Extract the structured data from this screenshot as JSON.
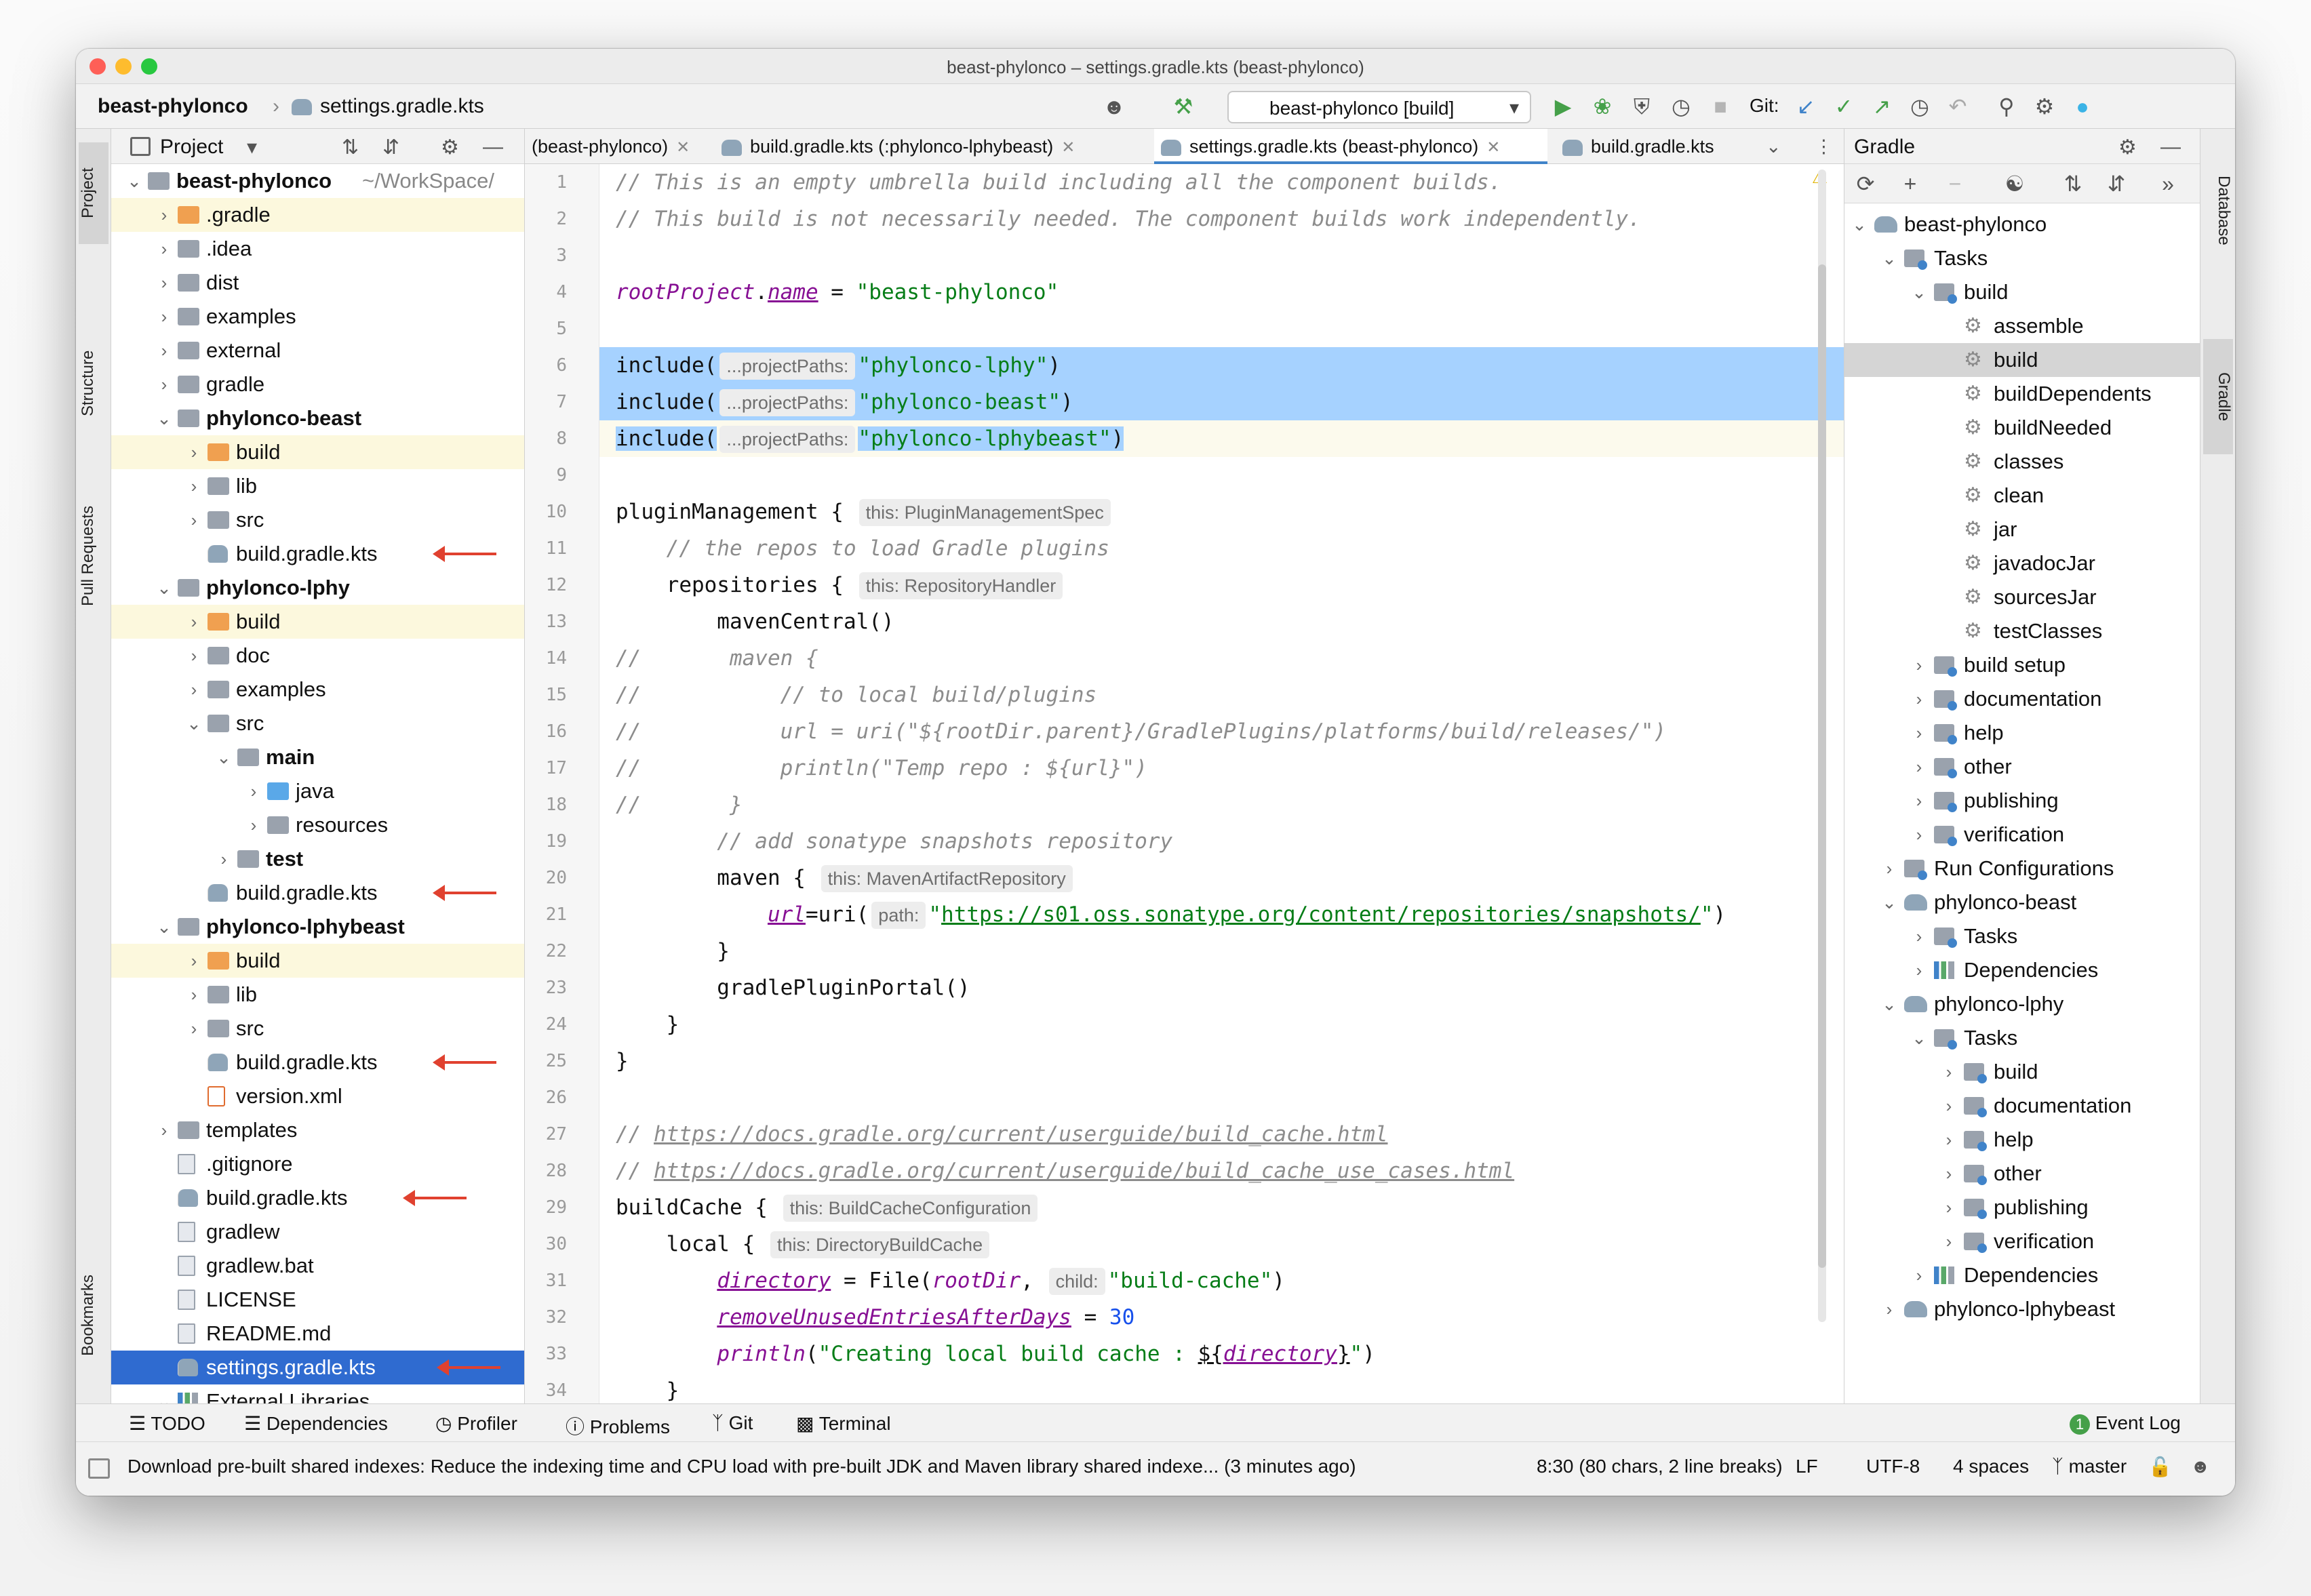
{
  "window": {
    "title": "beast-phylonco – settings.gradle.kts (beast-phylonco)",
    "traffic_colors": [
      "#fe5f57",
      "#febc2e",
      "#28c840"
    ]
  },
  "navbar": {
    "project": "beast-phylonco",
    "file": "settings.gradle.kts",
    "run_config": "beast-phylonco [build]",
    "git_label": "Git:"
  },
  "left_stripe": [
    "Project",
    "Structure",
    "Pull Requests",
    "Bookmarks"
  ],
  "right_stripe": [
    "Database",
    "Gradle"
  ],
  "project_panel": {
    "title": "Project",
    "root_label": "beast-phylonco",
    "root_path": "~/WorkSpace/",
    "items": [
      {
        "label": ".gradle",
        "depth": 1,
        "icon": "orange",
        "chev": "›",
        "hl": true
      },
      {
        "label": ".idea",
        "depth": 1,
        "icon": "grey",
        "chev": "›"
      },
      {
        "label": "dist",
        "depth": 1,
        "icon": "grey",
        "chev": "›"
      },
      {
        "label": "examples",
        "depth": 1,
        "icon": "grey",
        "chev": "›"
      },
      {
        "label": "external",
        "depth": 1,
        "icon": "grey",
        "chev": "›"
      },
      {
        "label": "gradle",
        "depth": 1,
        "icon": "grey",
        "chev": "›"
      },
      {
        "label": "phylonco-beast",
        "depth": 1,
        "icon": "grey",
        "chev": "⌄",
        "bold": true
      },
      {
        "label": "build",
        "depth": 2,
        "icon": "orange",
        "chev": "›",
        "hl": true
      },
      {
        "label": "lib",
        "depth": 2,
        "icon": "grey",
        "chev": "›"
      },
      {
        "label": "src",
        "depth": 2,
        "icon": "grey",
        "chev": "›"
      },
      {
        "label": "build.gradle.kts",
        "depth": 2,
        "icon": "gradle",
        "arrow": true
      },
      {
        "label": "phylonco-lphy",
        "depth": 1,
        "icon": "grey",
        "chev": "⌄",
        "bold": true
      },
      {
        "label": "build",
        "depth": 2,
        "icon": "orange",
        "chev": "›",
        "hl": true
      },
      {
        "label": "doc",
        "depth": 2,
        "icon": "grey",
        "chev": "›"
      },
      {
        "label": "examples",
        "depth": 2,
        "icon": "grey",
        "chev": "›"
      },
      {
        "label": "src",
        "depth": 2,
        "icon": "grey",
        "chev": "⌄"
      },
      {
        "label": "main",
        "depth": 3,
        "icon": "grey",
        "chev": "⌄",
        "bold": true
      },
      {
        "label": "java",
        "depth": 4,
        "icon": "blue",
        "chev": "›"
      },
      {
        "label": "resources",
        "depth": 4,
        "icon": "grey",
        "chev": "›"
      },
      {
        "label": "test",
        "depth": 3,
        "icon": "grey",
        "chev": "›",
        "bold": true
      },
      {
        "label": "build.gradle.kts",
        "depth": 2,
        "icon": "gradle",
        "arrow": true
      },
      {
        "label": "phylonco-lphybeast",
        "depth": 1,
        "icon": "grey",
        "chev": "⌄",
        "bold": true
      },
      {
        "label": "build",
        "depth": 2,
        "icon": "orange",
        "chev": "›",
        "hl": true
      },
      {
        "label": "lib",
        "depth": 2,
        "icon": "grey",
        "chev": "›"
      },
      {
        "label": "src",
        "depth": 2,
        "icon": "grey",
        "chev": "›"
      },
      {
        "label": "build.gradle.kts",
        "depth": 2,
        "icon": "gradle",
        "arrow": true
      },
      {
        "label": "version.xml",
        "depth": 2,
        "icon": "xml"
      },
      {
        "label": "templates",
        "depth": 1,
        "icon": "grey",
        "chev": "›"
      },
      {
        "label": ".gitignore",
        "depth": 1,
        "icon": "file"
      },
      {
        "label": "build.gradle.kts",
        "depth": 1,
        "icon": "gradle",
        "arrow": true
      },
      {
        "label": "gradlew",
        "depth": 1,
        "icon": "file"
      },
      {
        "label": "gradlew.bat",
        "depth": 1,
        "icon": "file"
      },
      {
        "label": "LICENSE",
        "depth": 1,
        "icon": "file"
      },
      {
        "label": "README.md",
        "depth": 1,
        "icon": "file"
      },
      {
        "label": "settings.gradle.kts",
        "depth": 1,
        "icon": "gradle",
        "arrow": true,
        "sel": true
      },
      {
        "label": "External Libraries",
        "depth": 1,
        "icon": "deps",
        "chev": "⌄"
      }
    ]
  },
  "editor": {
    "tabs": [
      {
        "label": "(beast-phylonco)",
        "active": false
      },
      {
        "label": "build.gradle.kts (:phylonco-lphybeast)",
        "active": false
      },
      {
        "label": "settings.gradle.kts (beast-phylonco)",
        "active": true
      },
      {
        "label": "build.gradle.kts",
        "active": false
      }
    ],
    "lines": [
      {
        "n": "1",
        "t": [
          [
            "cm",
            "// This is an empty umbrella build including all the component builds."
          ]
        ]
      },
      {
        "n": "2",
        "t": [
          [
            "cm",
            "// This build is not necessarily needed. The component builds work independently."
          ]
        ]
      },
      {
        "n": "3",
        "t": []
      },
      {
        "n": "4",
        "t": [
          [
            "prop",
            "rootProject"
          ],
          [
            "",
            "."
          ],
          [
            "prop und",
            "name"
          ],
          [
            "",
            " = "
          ],
          [
            "str",
            "\"beast-phylonco\""
          ]
        ]
      },
      {
        "n": "5",
        "t": []
      },
      {
        "n": "6",
        "bg": "sel",
        "t": [
          [
            "",
            "include("
          ],
          [
            "hint",
            "...projectPaths:"
          ],
          [
            "str",
            "\"phylonco-lphy\""
          ],
          [
            "",
            ")"
          ]
        ]
      },
      {
        "n": "7",
        "bg": "sel",
        "t": [
          [
            "",
            "include("
          ],
          [
            "hint",
            "...projectPaths:"
          ],
          [
            "str",
            "\"phylonco-beast\""
          ],
          [
            "",
            ")"
          ]
        ]
      },
      {
        "n": "8",
        "bg": "cursel",
        "t": [
          [
            "",
            "include("
          ],
          [
            "hint",
            "...projectPaths:"
          ],
          [
            "str",
            "\"phylonco-lphybeast\""
          ],
          [
            "",
            ")"
          ]
        ]
      },
      {
        "n": "9",
        "t": []
      },
      {
        "n": "10",
        "t": [
          [
            "",
            "pluginManagement { "
          ],
          [
            "hint",
            "this: PluginManagementSpec"
          ]
        ]
      },
      {
        "n": "11",
        "t": [
          [
            "cm",
            "    // the repos to load Gradle plugins"
          ]
        ]
      },
      {
        "n": "12",
        "t": [
          [
            "",
            "    repositories { "
          ],
          [
            "hint",
            "this: RepositoryHandler"
          ]
        ]
      },
      {
        "n": "13",
        "t": [
          [
            "",
            "        mavenCentral()"
          ]
        ]
      },
      {
        "n": "14",
        "t": [
          [
            "cm",
            "//       maven {"
          ]
        ]
      },
      {
        "n": "15",
        "t": [
          [
            "cm",
            "//           // to local build/plugins"
          ]
        ]
      },
      {
        "n": "16",
        "t": [
          [
            "cm",
            "//           url = uri(\"${rootDir.parent}/GradlePlugins/platforms/build/releases/\")"
          ]
        ]
      },
      {
        "n": "17",
        "t": [
          [
            "cm",
            "//           println(\"Temp repo : ${url}\")"
          ]
        ]
      },
      {
        "n": "18",
        "t": [
          [
            "cm",
            "//       }"
          ]
        ]
      },
      {
        "n": "19",
        "t": [
          [
            "cm",
            "        // add sonatype snapshots repository"
          ]
        ]
      },
      {
        "n": "20",
        "t": [
          [
            "",
            "        maven { "
          ],
          [
            "hint",
            "this: MavenArtifactRepository"
          ]
        ]
      },
      {
        "n": "21",
        "t": [
          [
            "",
            "            "
          ],
          [
            "prop und",
            "url"
          ],
          [
            "",
            "=uri("
          ],
          [
            "hint",
            "path:"
          ],
          [
            "str",
            "\""
          ],
          [
            "link",
            "https://s01.oss.sonatype.org/content/repositories/snapshots/"
          ],
          [
            "str",
            "\""
          ],
          [
            "",
            ")"
          ]
        ]
      },
      {
        "n": "22",
        "t": [
          [
            "",
            "        }"
          ]
        ]
      },
      {
        "n": "23",
        "t": [
          [
            "",
            "        gradlePluginPortal()"
          ]
        ]
      },
      {
        "n": "24",
        "t": [
          [
            "",
            "    }"
          ]
        ]
      },
      {
        "n": "25",
        "t": [
          [
            "",
            "}"
          ]
        ]
      },
      {
        "n": "26",
        "t": []
      },
      {
        "n": "27",
        "t": [
          [
            "cm",
            "// "
          ],
          [
            "cm-link",
            "https://docs.gradle.org/current/userguide/build_cache.html"
          ]
        ]
      },
      {
        "n": "28",
        "t": [
          [
            "cm",
            "// "
          ],
          [
            "cm-link",
            "https://docs.gradle.org/current/userguide/build_cache_use_cases.html"
          ]
        ]
      },
      {
        "n": "29",
        "t": [
          [
            "",
            "buildCache { "
          ],
          [
            "hint",
            "this: BuildCacheConfiguration"
          ]
        ]
      },
      {
        "n": "30",
        "t": [
          [
            "",
            "    local { "
          ],
          [
            "hint",
            "this: DirectoryBuildCache"
          ]
        ]
      },
      {
        "n": "31",
        "t": [
          [
            "",
            "        "
          ],
          [
            "prop und",
            "directory"
          ],
          [
            "",
            " = File("
          ],
          [
            "prop",
            "rootDir"
          ],
          [
            "",
            ", "
          ],
          [
            "hint",
            "child:"
          ],
          [
            "str",
            "\"build-cache\""
          ],
          [
            "",
            ")"
          ]
        ]
      },
      {
        "n": "32",
        "t": [
          [
            "",
            "        "
          ],
          [
            "prop und",
            "removeUnusedEntriesAfterDays"
          ],
          [
            "",
            " = "
          ],
          [
            "num",
            "30"
          ]
        ]
      },
      {
        "n": "33",
        "t": [
          [
            "",
            "        "
          ],
          [
            "prop",
            "println"
          ],
          [
            "",
            "("
          ],
          [
            "str",
            "\"Creating local build cache : "
          ],
          [
            "und",
            "${"
          ],
          [
            "prop und",
            "directory"
          ],
          [
            "und",
            "}"
          ],
          [
            "str",
            "\""
          ],
          [
            "",
            ")"
          ]
        ]
      },
      {
        "n": "34",
        "t": [
          [
            "",
            "    }"
          ]
        ]
      }
    ]
  },
  "gradle_panel": {
    "title": "Gradle",
    "items": [
      {
        "label": "beast-phylonco",
        "depth": 0,
        "icon": "elephant",
        "chev": "⌄"
      },
      {
        "label": "Tasks",
        "depth": 1,
        "icon": "gfolder",
        "chev": "⌄"
      },
      {
        "label": "build",
        "depth": 2,
        "icon": "gfolder",
        "chev": "⌄"
      },
      {
        "label": "assemble",
        "depth": 3,
        "icon": "gear"
      },
      {
        "label": "build",
        "depth": 3,
        "icon": "gear",
        "sel": true
      },
      {
        "label": "buildDependents",
        "depth": 3,
        "icon": "gear"
      },
      {
        "label": "buildNeeded",
        "depth": 3,
        "icon": "gear"
      },
      {
        "label": "classes",
        "depth": 3,
        "icon": "gear"
      },
      {
        "label": "clean",
        "depth": 3,
        "icon": "gear"
      },
      {
        "label": "jar",
        "depth": 3,
        "icon": "gear"
      },
      {
        "label": "javadocJar",
        "depth": 3,
        "icon": "gear"
      },
      {
        "label": "sourcesJar",
        "depth": 3,
        "icon": "gear"
      },
      {
        "label": "testClasses",
        "depth": 3,
        "icon": "gear"
      },
      {
        "label": "build setup",
        "depth": 2,
        "icon": "gfolder",
        "chev": "›"
      },
      {
        "label": "documentation",
        "depth": 2,
        "icon": "gfolder",
        "chev": "›"
      },
      {
        "label": "help",
        "depth": 2,
        "icon": "gfolder",
        "chev": "›"
      },
      {
        "label": "other",
        "depth": 2,
        "icon": "gfolder",
        "chev": "›"
      },
      {
        "label": "publishing",
        "depth": 2,
        "icon": "gfolder",
        "chev": "›"
      },
      {
        "label": "verification",
        "depth": 2,
        "icon": "gfolder",
        "chev": "›"
      },
      {
        "label": "Run Configurations",
        "depth": 1,
        "icon": "gfolder",
        "chev": "›"
      },
      {
        "label": "phylonco-beast",
        "depth": 1,
        "icon": "elephant",
        "chev": "⌄"
      },
      {
        "label": "Tasks",
        "depth": 2,
        "icon": "gfolder",
        "chev": "›"
      },
      {
        "label": "Dependencies",
        "depth": 2,
        "icon": "deps",
        "chev": "›"
      },
      {
        "label": "phylonco-lphy",
        "depth": 1,
        "icon": "elephant",
        "chev": "⌄"
      },
      {
        "label": "Tasks",
        "depth": 2,
        "icon": "gfolder",
        "chev": "⌄"
      },
      {
        "label": "build",
        "depth": 3,
        "icon": "gfolder",
        "chev": "›"
      },
      {
        "label": "documentation",
        "depth": 3,
        "icon": "gfolder",
        "chev": "›"
      },
      {
        "label": "help",
        "depth": 3,
        "icon": "gfolder",
        "chev": "›"
      },
      {
        "label": "other",
        "depth": 3,
        "icon": "gfolder",
        "chev": "›"
      },
      {
        "label": "publishing",
        "depth": 3,
        "icon": "gfolder",
        "chev": "›"
      },
      {
        "label": "verification",
        "depth": 3,
        "icon": "gfolder",
        "chev": "›"
      },
      {
        "label": "Dependencies",
        "depth": 2,
        "icon": "deps",
        "chev": "›"
      },
      {
        "label": "phylonco-lphybeast",
        "depth": 1,
        "icon": "elephant",
        "chev": "›"
      }
    ]
  },
  "bottom_tools": [
    "TODO",
    "Dependencies",
    "Profiler",
    "Problems",
    "Git",
    "Terminal"
  ],
  "event_log": {
    "label": "Event Log",
    "count": "1"
  },
  "status": {
    "message": "Download pre-built shared indexes: Reduce the indexing time and CPU load with pre-built JDK and Maven library shared indexe... (3 minutes ago)",
    "position": "8:30 (80 chars, 2 line breaks)",
    "line_sep": "LF",
    "encoding": "UTF-8",
    "indent": "4 spaces",
    "branch": "master"
  },
  "colors": {
    "selection": "#a6d2ff",
    "tree_selected": "#2f6bd0",
    "excluded_highlight": "#fcf8dd",
    "annotation_arrow": "#e0412f",
    "run_green": "#45a049"
  }
}
